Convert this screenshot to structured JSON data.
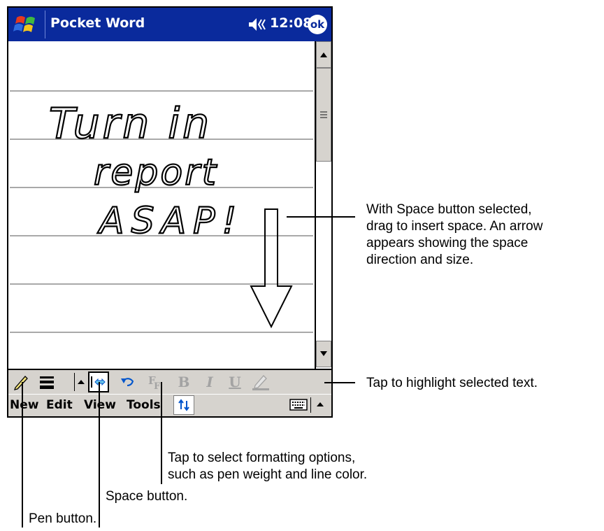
{
  "titlebar": {
    "app_title": "Pocket Word",
    "clock": "12:08",
    "ok_label": "ok"
  },
  "menus": [
    "New",
    "Edit",
    "View",
    "Tools"
  ],
  "toolbar": {
    "bold": "B",
    "italic": "I",
    "underline": "U"
  },
  "handwriting": [
    "Turn in",
    "report",
    "ASAP!"
  ],
  "callouts": {
    "space_arrow": [
      "With Space button selected,",
      "drag to insert space. An arrow",
      "appears showing the space",
      "direction and size."
    ],
    "highlight": "Tap to highlight selected text.",
    "formatting": [
      "Tap to select formatting options,",
      "such as pen weight and line color."
    ],
    "space_button": "Space button.",
    "pen_button": "Pen button."
  },
  "colors": {
    "titlebar": "#0a2a9c",
    "toolbar": "#d6d3ce",
    "accent": "#0055cc"
  }
}
